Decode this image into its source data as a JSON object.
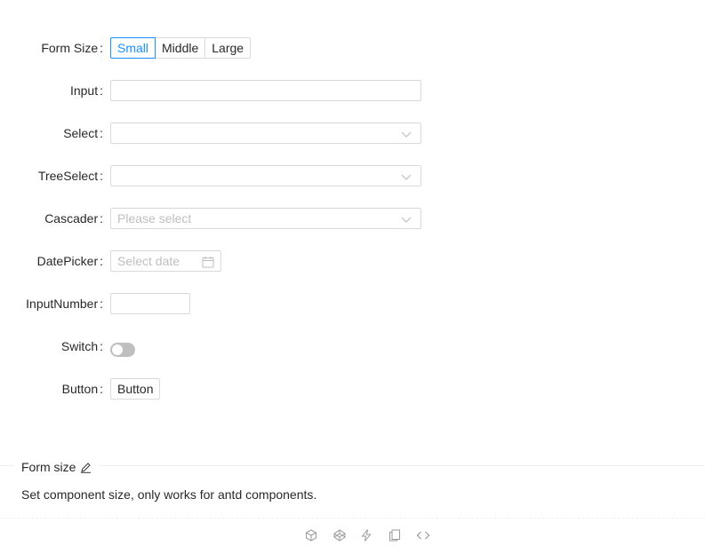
{
  "form": {
    "form_size": {
      "label": "Form Size",
      "options": [
        "Small",
        "Middle",
        "Large"
      ],
      "selected": "Small"
    },
    "input": {
      "label": "Input",
      "value": ""
    },
    "select": {
      "label": "Select",
      "value": ""
    },
    "tree_select": {
      "label": "TreeSelect",
      "value": ""
    },
    "cascader": {
      "label": "Cascader",
      "placeholder": "Please select"
    },
    "date_picker": {
      "label": "DatePicker",
      "placeholder": "Select date"
    },
    "input_number": {
      "label": "InputNumber",
      "value": ""
    },
    "switch": {
      "label": "Switch",
      "checked": false
    },
    "button": {
      "label": "Button",
      "text": "Button"
    }
  },
  "demo": {
    "title": "Form size",
    "description": "Set component size, only works for antd components.",
    "actions": [
      "codesandbox-icon",
      "codepen-icon",
      "stackblitz-icon",
      "copy-icon",
      "code-icon"
    ]
  },
  "colors": {
    "primary": "#1890ff",
    "border": "#d9d9d9",
    "placeholder": "#bfbfbf"
  }
}
